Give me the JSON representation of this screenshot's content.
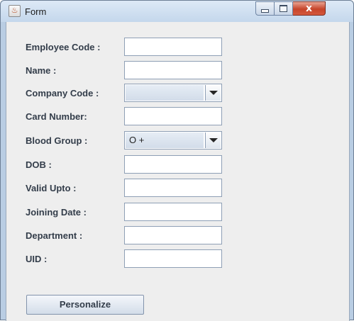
{
  "window": {
    "title": "Form",
    "close_glyph": "x"
  },
  "form": {
    "fields": [
      {
        "label": "Employee Code :",
        "value": ""
      },
      {
        "label": "Name :",
        "value": ""
      },
      {
        "label": "Company Code :",
        "value": "",
        "type": "dropdown"
      },
      {
        "label": "Card Number:",
        "value": ""
      },
      {
        "label": "Blood Group :",
        "value": "O +",
        "type": "dropdown"
      },
      {
        "label": "DOB :",
        "value": ""
      },
      {
        "label": "Valid Upto :",
        "value": ""
      },
      {
        "label": "Joining Date :",
        "value": ""
      },
      {
        "label": "Department :",
        "value": ""
      },
      {
        "label": "UID :",
        "value": ""
      }
    ],
    "button_label": "Personalize"
  },
  "icons": {
    "app": "java-coffee-cup-icon",
    "minimize": "minimize-icon",
    "maximize": "maximize-icon",
    "close": "close-icon",
    "dropdown": "chevron-down-icon"
  },
  "colors": {
    "titlebar": "#c4d7ec",
    "client_bg": "#eeeeee",
    "close_button": "#c6442a",
    "label_text": "#333d4a"
  }
}
